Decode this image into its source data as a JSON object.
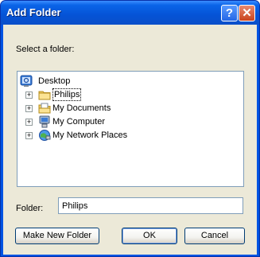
{
  "window": {
    "title": "Add Folder",
    "help_glyph": "?",
    "close_glyph": "✕"
  },
  "prompt": "Select a folder:",
  "tree": {
    "root": {
      "label": "Desktop",
      "icon": "desktop-icon"
    },
    "items": [
      {
        "label": "Philips",
        "icon": "folder-icon",
        "selected": true
      },
      {
        "label": "My Documents",
        "icon": "my-documents-icon"
      },
      {
        "label": "My Computer",
        "icon": "my-computer-icon"
      },
      {
        "label": "My Network Places",
        "icon": "network-places-icon"
      }
    ]
  },
  "folder": {
    "label": "Folder:",
    "value": "Philips"
  },
  "buttons": {
    "make_new_folder": "Make New Folder",
    "ok": "OK",
    "cancel": "Cancel"
  },
  "colors": {
    "title_bar": "#0a5fd8",
    "dialog_bg": "#ece9d8",
    "close_button": "#c9431c"
  }
}
